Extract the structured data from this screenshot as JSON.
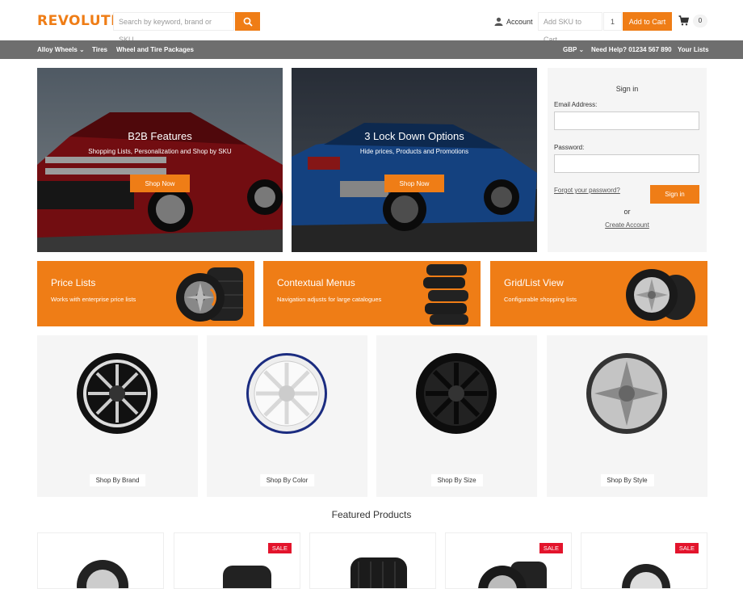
{
  "brand": {
    "logo_text": "REVOLUTION",
    "accent": "#ef7d16"
  },
  "header": {
    "search_placeholder": "Search by keyword, brand or SKU",
    "account_label": "Account",
    "sku_placeholder": "Add SKU to Cart",
    "qty_value": "1",
    "add_to_cart_label": "Add to Cart",
    "cart_count": "0"
  },
  "nav": {
    "left": [
      "Alloy Wheels",
      "Tires",
      "Wheel and Tire Packages"
    ],
    "currency": "GBP",
    "help": "Need Help? 01234 567 890",
    "lists": "Your Lists"
  },
  "hero": [
    {
      "title": "B2B Features",
      "subtitle": "Shopping Lists, Personalization and Shop by SKU",
      "button": "Shop Now"
    },
    {
      "title": "3 Lock Down Options",
      "subtitle": "Hide prices, Products and Promotions",
      "button": "Shop Now"
    }
  ],
  "signin": {
    "title": "Sign in",
    "email_label": "Email Address:",
    "password_label": "Password:",
    "forgot": "Forgot your password?",
    "button": "Sign in",
    "or": "or",
    "create": "Create Account"
  },
  "promos": [
    {
      "title": "Price Lists",
      "subtitle": "Works with enterprise price lists"
    },
    {
      "title": "Contextual Menus",
      "subtitle": "Navigation adjusts for large catalogues"
    },
    {
      "title": "Grid/List View",
      "subtitle": "Configurable shopping lists"
    }
  ],
  "categories": [
    "Shop By Brand",
    "Shop By Color",
    "Shop By Size",
    "Shop By Style"
  ],
  "featured_title": "Featured Products",
  "sale_label": "SALE"
}
